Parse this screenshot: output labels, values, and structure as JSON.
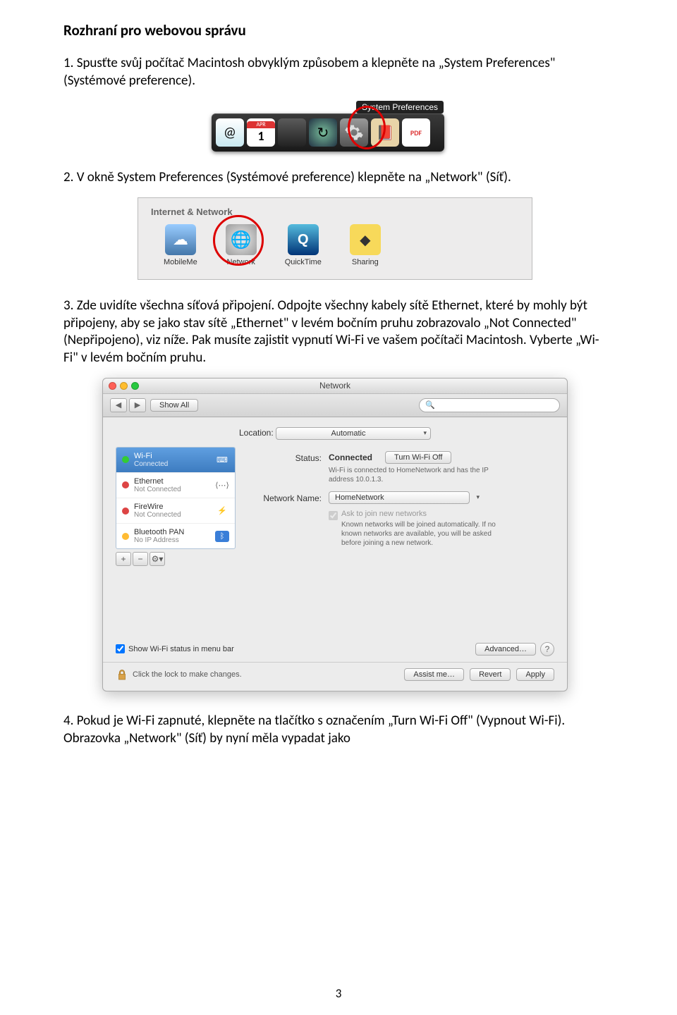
{
  "doc": {
    "title": "Rozhraní pro webovou správu",
    "step1": "1. Spusťte svůj počítač Macintosh obvyklým způsobem a klepněte na „System Preferences\" (Systémové preference).",
    "step2": "2. V okně System Preferences (Systémové preference) klepněte na „Network\" (Síť).",
    "step3": "3. Zde uvidíte všechna síťová připojení. Odpojte všechny kabely sítě Ethernet, které by mohly být připojeny, aby se jako stav sítě „Ethernet\" v levém bočním pruhu zobrazovalo „Not Connected\" (Nepřipojeno), viz níže. Pak musíte zajistit vypnutí Wi-Fi ve vašem počítači Macintosh. Vyberte „Wi-Fi\" v levém bočním pruhu.",
    "step4": "4. Pokud je Wi-Fi zapnuté, klepněte na tlačítko s označením „Turn Wi-Fi Off\" (Vypnout Wi-Fi). Obrazovka „Network\" (Síť) by nyní měla vypadat jako",
    "page_num": "3"
  },
  "dock": {
    "tooltip": "System Preferences",
    "cal_month": "APR",
    "cal_day": "1",
    "pdf": "PDF"
  },
  "inet": {
    "section": "Internet & Network",
    "items": [
      "MobileMe",
      "Network",
      "QuickTime",
      "Sharing"
    ]
  },
  "netwin": {
    "title": "Network",
    "show_all": "Show All",
    "search_placeholder": "",
    "location_label": "Location:",
    "location_value": "Automatic",
    "sidebar": [
      {
        "name": "Wi-Fi",
        "sub": "Connected",
        "dot": "green",
        "icon": "wifi"
      },
      {
        "name": "Ethernet",
        "sub": "Not Connected",
        "dot": "red",
        "icon": "eth"
      },
      {
        "name": "FireWire",
        "sub": "Not Connected",
        "dot": "red",
        "icon": "fw"
      },
      {
        "name": "Bluetooth PAN",
        "sub": "No IP Address",
        "dot": "amber",
        "icon": "bt"
      }
    ],
    "status_label": "Status:",
    "status_val": "Connected",
    "turn_off": "Turn Wi-Fi Off",
    "status_sub": "Wi-Fi is connected to HomeNetwork and has the IP address 10.0.1.3.",
    "netname_label": "Network Name:",
    "netname_val": "HomeNetwork",
    "ask_join": "Ask to join new networks",
    "ask_sub": "Known networks will be joined automatically. If no known networks are available, you will be asked before joining a new network.",
    "show_menu": "Show Wi-Fi status in menu bar",
    "advanced": "Advanced…",
    "lock_text": "Click the lock to make changes.",
    "assist": "Assist me…",
    "revert": "Revert",
    "apply": "Apply"
  }
}
